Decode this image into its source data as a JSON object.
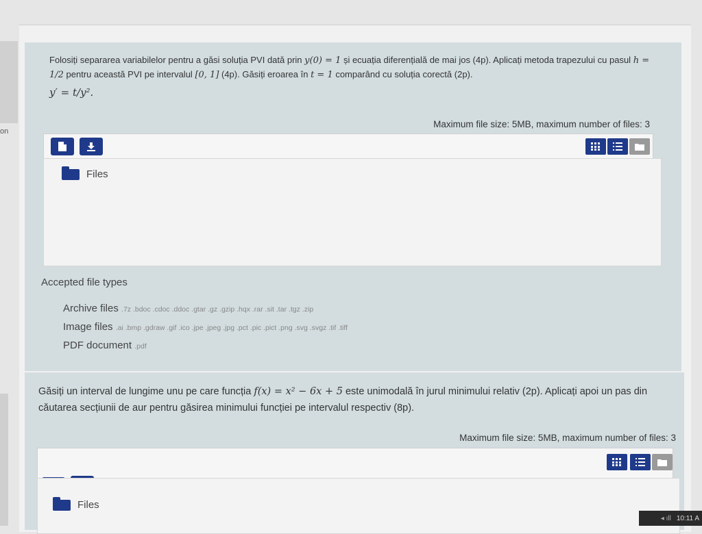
{
  "sidebar": {
    "label": "on"
  },
  "questions": [
    {
      "text_part1": "Folosiți separarea variabilelor pentru a găsi soluția PVI dată prin ",
      "cond": "y(0) = 1",
      "text_part2": " și ecuația diferențială de mai jos (4p). Aplicați metoda trapezului cu pasul ",
      "step": "h = 1/2",
      "text_part3": " pentru această PVI pe intervalul ",
      "interval": "[0, 1]",
      "text_part4": " (4p). Găsiți eroarea în ",
      "tpoint": "t = 1",
      "text_part5": " comparând cu soluția corectă (2p).",
      "equation": "y′ = t/y².",
      "max_info": "Maximum file size: 5MB, maximum number of files: 3",
      "folder_label": "Files",
      "accepted_title": "Accepted file types",
      "file_types": [
        {
          "label": "Archive files",
          "ext": ".7z .bdoc .cdoc .ddoc .gtar .gz .gzip .hqx .rar .sit .tar .tgz .zip"
        },
        {
          "label": "Image files",
          "ext": ".ai .bmp .gdraw .gif .ico .jpe .jpeg .jpg .pct .pic .pict .png .svg .svgz .tif .tiff"
        },
        {
          "label": "PDF document",
          "ext": ".pdf"
        }
      ]
    },
    {
      "text_part1": "Găsiți un interval de lungime unu pe care funcția ",
      "func": "f(x) = x² − 6x + 5",
      "text_part2": " este unimodală în jurul minimului relativ (2p). Aplicați apoi un pas din căutarea secțiunii de aur pentru găsirea minimului funcției pe intervalul respectiv (8p).",
      "max_info": "Maximum file size: 5MB, maximum number of files: 3",
      "folder_label": "Files"
    }
  ],
  "taskbar": {
    "time": "10:11 A",
    "tray": "◂ ıll"
  },
  "colors": {
    "accent": "#1f3a8a",
    "panel": "#d3dde0",
    "grey_button": "#9a9a9a"
  },
  "icons": [
    "add-file-icon",
    "download-icon",
    "grid-view-icon",
    "list-view-icon",
    "folder-view-icon",
    "folder-icon"
  ]
}
